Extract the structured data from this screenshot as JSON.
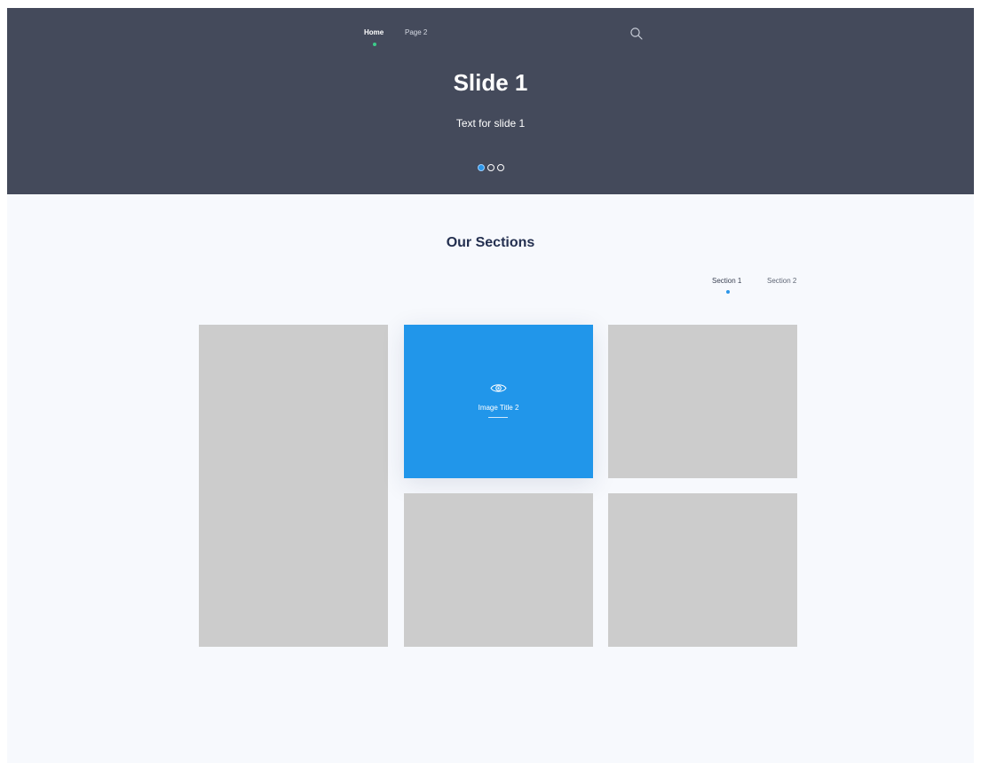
{
  "nav": {
    "items": [
      {
        "label": "Home",
        "active": true
      },
      {
        "label": "Page 2",
        "active": false
      }
    ],
    "search_icon": "search-icon"
  },
  "hero": {
    "title": "Slide 1",
    "text": "Text for slide 1",
    "slides_total": 3,
    "active_slide": 1
  },
  "sections": {
    "title": "Our Sections",
    "tabs": [
      {
        "label": "Section 1",
        "active": true
      },
      {
        "label": "Section 2",
        "active": false
      }
    ],
    "tiles": [
      {
        "highlighted": false
      },
      {
        "highlighted": true,
        "title": "Image Title 2",
        "icon": "eye-icon"
      },
      {
        "highlighted": false
      },
      {
        "highlighted": false
      },
      {
        "highlighted": false
      }
    ]
  },
  "colors": {
    "hero_bg": "#444a5b",
    "page_bg": "#f7f9fd",
    "accent_blue": "#2196ea",
    "nav_indicator": "#3ccc8a",
    "tile_placeholder": "#cccccc"
  }
}
